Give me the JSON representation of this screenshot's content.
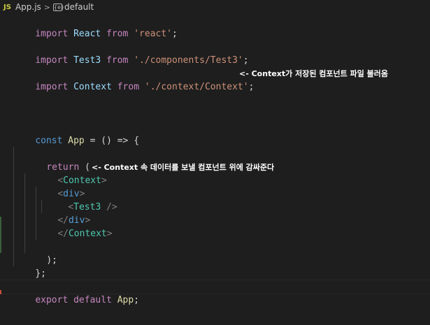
{
  "breadcrumb": {
    "lang_badge": "JS",
    "file": "App.js",
    "separator": ">",
    "symbol_icon": "{e}",
    "symbol": "default"
  },
  "code": {
    "l1": {
      "kw": "import",
      "name": "React",
      "from": "from",
      "path": "'react'",
      "semi": ";"
    },
    "l2": {
      "kw": "import",
      "name": "Test3",
      "from": "from",
      "path": "'./components/Test3'",
      "semi": ";"
    },
    "l3": {
      "kw": "import",
      "name": "Context",
      "from": "from",
      "path": "'./context/Context'",
      "semi": ";"
    },
    "l4": {
      "kw": "const",
      "name": "App",
      "op": " = () => {"
    },
    "l5": {
      "kw": "return",
      "rest": " ("
    },
    "l6": {
      "open": "<",
      "tag": "Context",
      "close": ">"
    },
    "l7": {
      "open": "<",
      "tag": "div",
      "close": ">"
    },
    "l8": {
      "open": "<",
      "tag": "Test3",
      "close": " />"
    },
    "l9": {
      "open": "</",
      "tag": "div",
      "close": ">"
    },
    "l10": {
      "open": "</",
      "tag": "Context",
      "close": ">"
    },
    "l11": {
      "text": ");"
    },
    "l12": {
      "text": "};"
    },
    "l13": {
      "kw1": "export",
      "kw2": "default",
      "name": "App",
      "semi": ";"
    }
  },
  "annotations": {
    "import_note": "<- Context가 저장된 컴포넌트 파일 불러옴",
    "wrap_note": "<- Context 속 데이터를 보낼 컴포넌트 위에 감싸준다"
  },
  "colors": {
    "background": "#1e1e1e",
    "keyword": "#569cd6",
    "control": "#c586c0",
    "variable": "#9cdcfe",
    "string": "#ce9178",
    "tag": "#4ec9b0"
  }
}
